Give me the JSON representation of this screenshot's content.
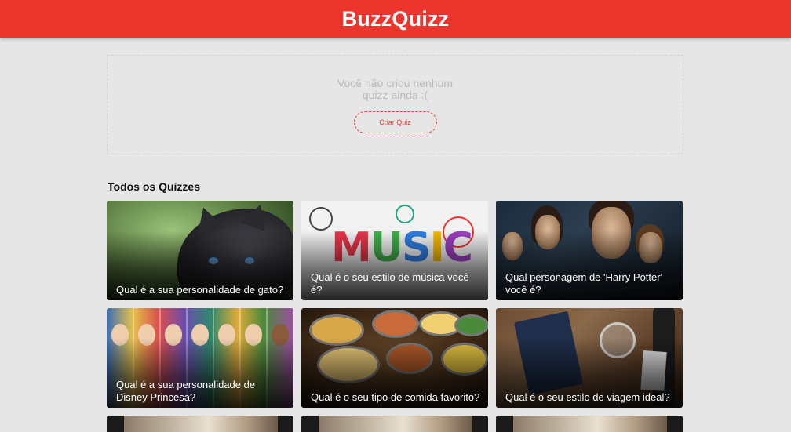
{
  "header": {
    "title": "BuzzQuizz"
  },
  "my_quizzes": {
    "empty_message": "Você não criou nenhum quizz ainda :(",
    "create_button": "Criar Quiz"
  },
  "all_quizzes": {
    "heading": "Todos os Quizzes",
    "items": [
      {
        "title": "Qual é a sua personalidade de gato?"
      },
      {
        "title": "Qual é o seu estilo de música você é?"
      },
      {
        "title": "Qual personagem de 'Harry Potter' você é?"
      },
      {
        "title": "Qual é a sua personalidade de Disney Princesa?"
      },
      {
        "title": "Qual é o seu tipo de comida favorito?"
      },
      {
        "title": "Qual é o seu estilo de viagem ideal?"
      }
    ]
  },
  "colors": {
    "brand": "#ec362d",
    "background": "#e6e6e6"
  }
}
